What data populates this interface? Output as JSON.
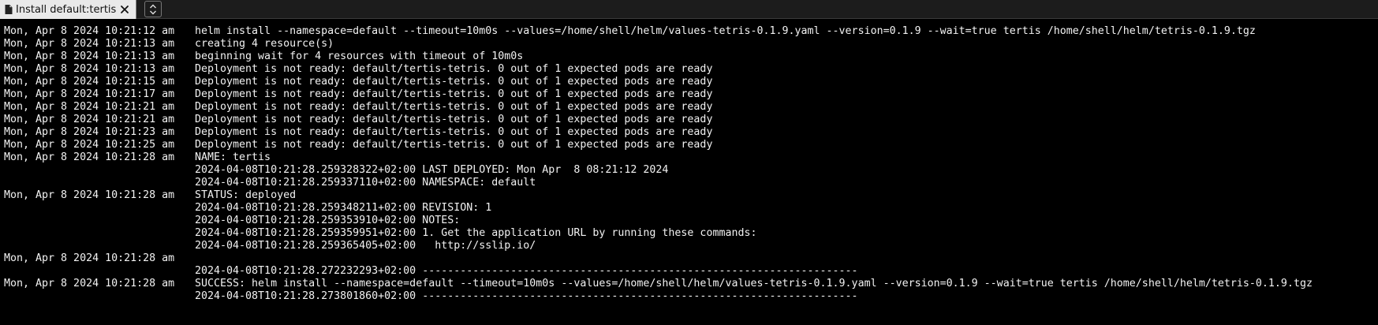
{
  "tab": {
    "title": "Install default:tertis",
    "doc_icon": "document-icon",
    "close_icon": "close-icon",
    "menu_icon": "chevron-up-down-icon"
  },
  "log": [
    {
      "ts": "Mon, Apr 8 2024 10:21:12 am",
      "msg": "helm install --namespace=default --timeout=10m0s --values=/home/shell/helm/values-tetris-0.1.9.yaml --version=0.1.9 --wait=true tertis /home/shell/helm/tetris-0.1.9.tgz"
    },
    {
      "ts": "Mon, Apr 8 2024 10:21:13 am",
      "msg": "creating 4 resource(s)"
    },
    {
      "ts": "Mon, Apr 8 2024 10:21:13 am",
      "msg": "beginning wait for 4 resources with timeout of 10m0s"
    },
    {
      "ts": "Mon, Apr 8 2024 10:21:13 am",
      "msg": "Deployment is not ready: default/tertis-tetris. 0 out of 1 expected pods are ready"
    },
    {
      "ts": "Mon, Apr 8 2024 10:21:15 am",
      "msg": "Deployment is not ready: default/tertis-tetris. 0 out of 1 expected pods are ready"
    },
    {
      "ts": "Mon, Apr 8 2024 10:21:17 am",
      "msg": "Deployment is not ready: default/tertis-tetris. 0 out of 1 expected pods are ready"
    },
    {
      "ts": "Mon, Apr 8 2024 10:21:21 am",
      "msg": "Deployment is not ready: default/tertis-tetris. 0 out of 1 expected pods are ready"
    },
    {
      "ts": "Mon, Apr 8 2024 10:21:21 am",
      "msg": "Deployment is not ready: default/tertis-tetris. 0 out of 1 expected pods are ready"
    },
    {
      "ts": "Mon, Apr 8 2024 10:21:23 am",
      "msg": "Deployment is not ready: default/tertis-tetris. 0 out of 1 expected pods are ready"
    },
    {
      "ts": "Mon, Apr 8 2024 10:21:25 am",
      "msg": "Deployment is not ready: default/tertis-tetris. 0 out of 1 expected pods are ready"
    },
    {
      "ts": "Mon, Apr 8 2024 10:21:28 am",
      "msg": "NAME: tertis"
    },
    {
      "ts": "",
      "msg": "2024-04-08T10:21:28.259328322+02:00 LAST DEPLOYED: Mon Apr  8 08:21:12 2024"
    },
    {
      "ts": "",
      "msg": "2024-04-08T10:21:28.259337110+02:00 NAMESPACE: default"
    },
    {
      "ts": "Mon, Apr 8 2024 10:21:28 am",
      "msg": "STATUS: deployed"
    },
    {
      "ts": "",
      "msg": "2024-04-08T10:21:28.259348211+02:00 REVISION: 1"
    },
    {
      "ts": "",
      "msg": "2024-04-08T10:21:28.259353910+02:00 NOTES:"
    },
    {
      "ts": "",
      "msg": "2024-04-08T10:21:28.259359951+02:00 1. Get the application URL by running these commands:"
    },
    {
      "ts": "",
      "msg": "2024-04-08T10:21:28.259365405+02:00   http://sslip.io/"
    },
    {
      "ts": "Mon, Apr 8 2024 10:21:28 am",
      "msg": ""
    },
    {
      "ts": "",
      "msg": "2024-04-08T10:21:28.272232293+02:00 ---------------------------------------------------------------------"
    },
    {
      "ts": "Mon, Apr 8 2024 10:21:28 am",
      "msg": "SUCCESS: helm install --namespace=default --timeout=10m0s --values=/home/shell/helm/values-tetris-0.1.9.yaml --version=0.1.9 --wait=true tertis /home/shell/helm/tetris-0.1.9.tgz"
    },
    {
      "ts": "",
      "msg": "2024-04-08T10:21:28.273801860+02:00 ---------------------------------------------------------------------"
    }
  ]
}
